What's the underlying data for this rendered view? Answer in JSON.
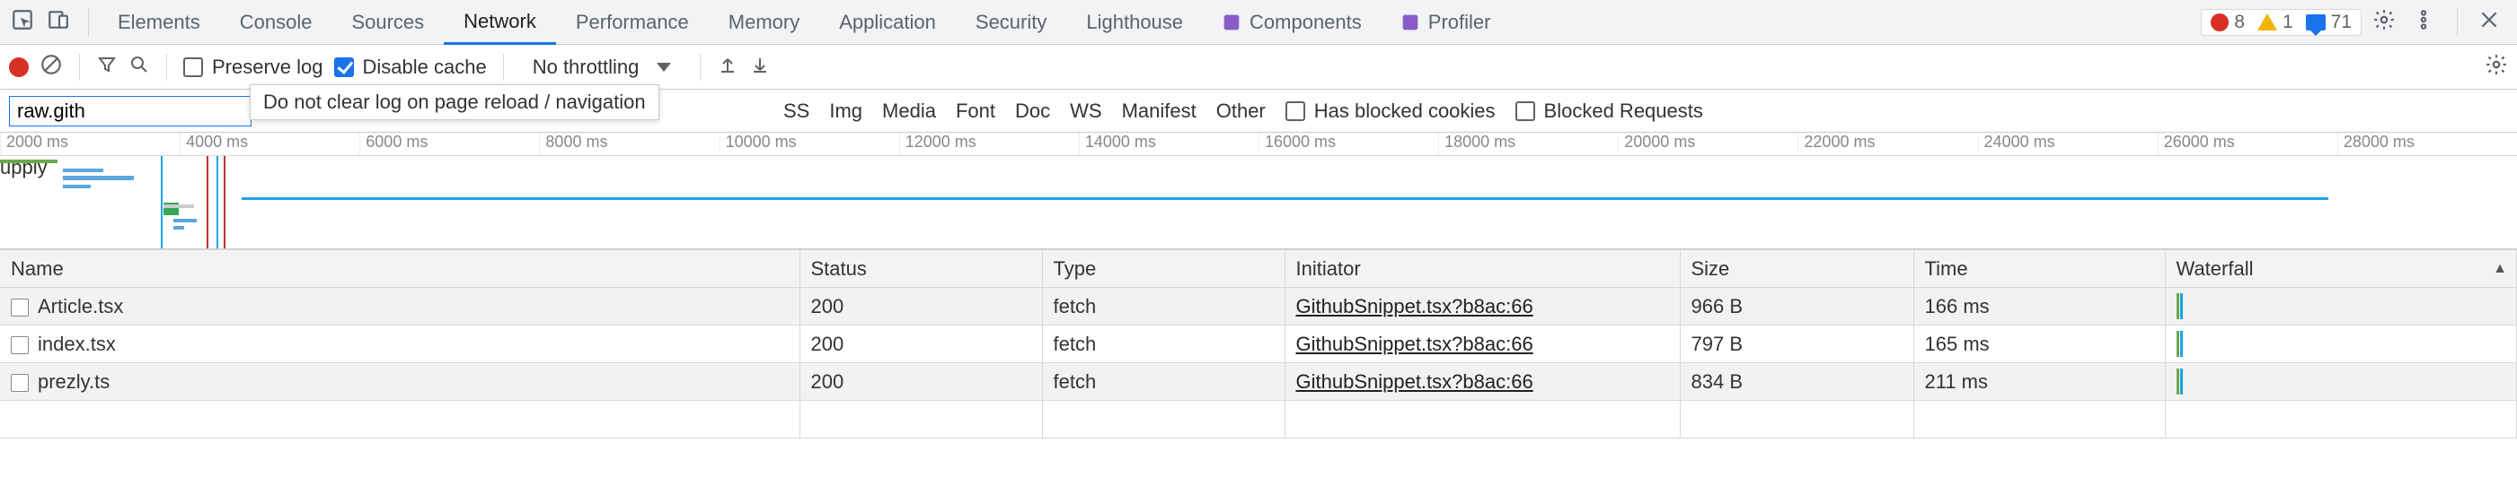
{
  "tabs": {
    "items": [
      "Elements",
      "Console",
      "Sources",
      "Network",
      "Performance",
      "Memory",
      "Application",
      "Security",
      "Lighthouse",
      "Components",
      "Profiler"
    ],
    "active": "Network"
  },
  "status_counts": {
    "errors": "8",
    "warnings": "1",
    "messages": "71"
  },
  "toolbar": {
    "preserve_log_label": "Preserve log",
    "disable_cache_label": "Disable cache",
    "throttling_label": "No throttling",
    "tooltip_text": "Do not clear log on page reload / navigation"
  },
  "filter": {
    "input_value": "raw.gith",
    "types_tail": [
      "SS",
      "Img",
      "Media",
      "Font",
      "Doc",
      "WS",
      "Manifest",
      "Other"
    ],
    "has_blocked_cookies_label": "Has blocked cookies",
    "blocked_requests_label": "Blocked Requests"
  },
  "timeline": {
    "ticks": [
      "2000 ms",
      "4000 ms",
      "6000 ms",
      "8000 ms",
      "10000 ms",
      "12000 ms",
      "14000 ms",
      "16000 ms",
      "18000 ms",
      "20000 ms",
      "22000 ms",
      "24000 ms",
      "26000 ms",
      "28000 ms"
    ]
  },
  "table": {
    "headers": [
      "Name",
      "Status",
      "Type",
      "Initiator",
      "Size",
      "Time",
      "Waterfall"
    ],
    "rows": [
      {
        "name": "Article.tsx",
        "status": "200",
        "type": "fetch",
        "initiator": "GithubSnippet.tsx?b8ac:66",
        "size": "966 B",
        "time": "166 ms"
      },
      {
        "name": "index.tsx",
        "status": "200",
        "type": "fetch",
        "initiator": "GithubSnippet.tsx?b8ac:66",
        "size": "797 B",
        "time": "165 ms"
      },
      {
        "name": "prezly.ts",
        "status": "200",
        "type": "fetch",
        "initiator": "GithubSnippet.tsx?b8ac:66",
        "size": "834 B",
        "time": "211 ms"
      }
    ]
  }
}
